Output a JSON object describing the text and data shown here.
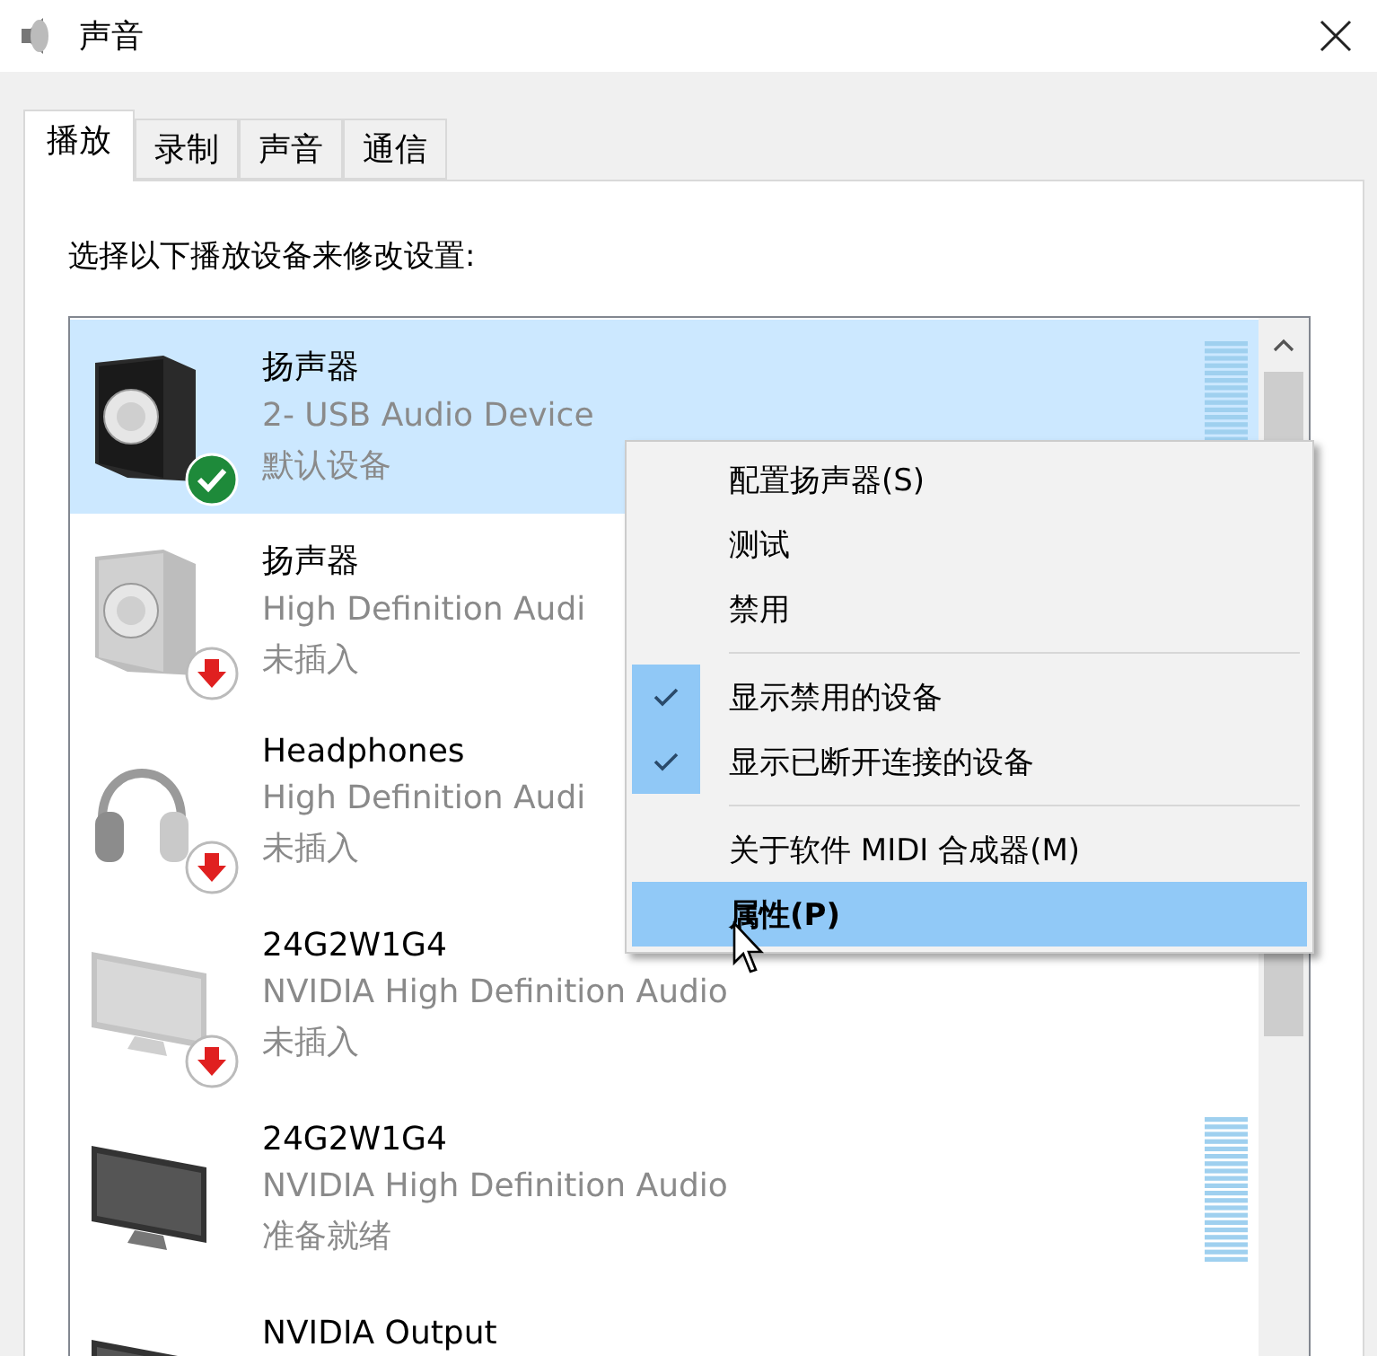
{
  "window": {
    "title": "声音"
  },
  "tabs": [
    {
      "label": "播放",
      "selected": true
    },
    {
      "label": "录制",
      "selected": false
    },
    {
      "label": "声音",
      "selected": false
    },
    {
      "label": "通信",
      "selected": false
    }
  ],
  "instruction": "选择以下播放设备来修改设置:",
  "devices": [
    {
      "kind": "speaker",
      "name": "扬声器",
      "driver": "2- USB Audio Device",
      "status": "默认设备",
      "default": true,
      "unplugged": false,
      "selected": true,
      "meter": true
    },
    {
      "kind": "speaker",
      "name": "扬声器",
      "driver": "High Definition Audi",
      "status": "未插入",
      "default": false,
      "unplugged": true,
      "selected": false,
      "meter": false
    },
    {
      "kind": "headphones",
      "name": "Headphones",
      "driver": "High Definition Audi",
      "status": "未插入",
      "default": false,
      "unplugged": true,
      "selected": false,
      "meter": false
    },
    {
      "kind": "monitor",
      "name": "24G2W1G4",
      "driver": "NVIDIA High Definition Audio",
      "status": "未插入",
      "default": false,
      "unplugged": true,
      "selected": false,
      "meter": false
    },
    {
      "kind": "monitor",
      "name": "24G2W1G4",
      "driver": "NVIDIA High Definition Audio",
      "status": "准备就绪",
      "default": false,
      "unplugged": false,
      "selected": false,
      "meter": true
    },
    {
      "kind": "monitor",
      "name": "NVIDIA Output",
      "default": false,
      "unplugged": false,
      "selected": false,
      "meter": false
    }
  ],
  "context_menu": [
    {
      "kind": "item",
      "label": "配置扬声器(S)",
      "checked": false,
      "selected": false,
      "bold": false
    },
    {
      "kind": "item",
      "label": "测试",
      "checked": false,
      "selected": false,
      "bold": false
    },
    {
      "kind": "item",
      "label": "禁用",
      "checked": false,
      "selected": false,
      "bold": false
    },
    {
      "kind": "separator"
    },
    {
      "kind": "item",
      "label": "显示禁用的设备",
      "checked": true,
      "selected": false,
      "bold": false
    },
    {
      "kind": "item",
      "label": "显示已断开连接的设备",
      "checked": true,
      "selected": false,
      "bold": false
    },
    {
      "kind": "separator"
    },
    {
      "kind": "item",
      "label": "关于软件 MIDI 合成器(M)",
      "checked": false,
      "selected": false,
      "bold": false
    },
    {
      "kind": "item",
      "label": "属性(P)",
      "checked": false,
      "selected": true,
      "bold": true
    }
  ]
}
